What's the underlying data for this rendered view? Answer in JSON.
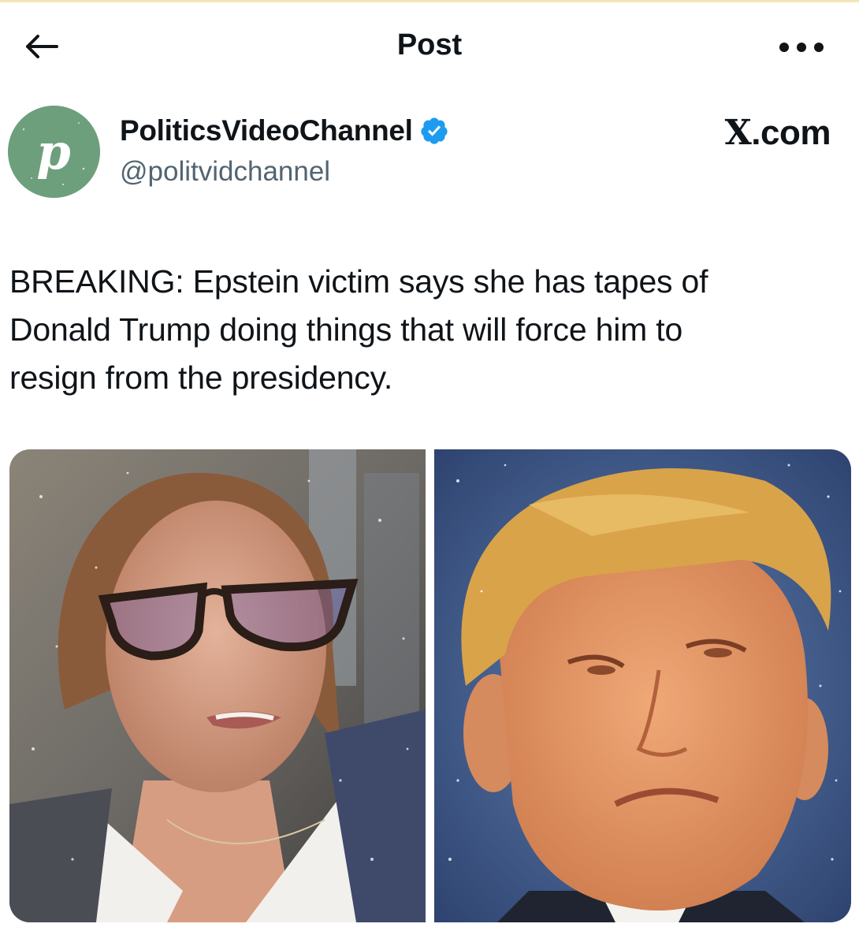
{
  "header": {
    "title": "Post",
    "back_icon": "arrow-left-icon",
    "more_icon": "more-horizontal-icon"
  },
  "author": {
    "name": "PoliticsVideoChannel",
    "handle": "@politvidchannel",
    "avatar_letter": "p",
    "avatar_color": "#6e9f7d",
    "verified_color": "#1d9bf0"
  },
  "brand": {
    "x_glyph": "X",
    "suffix": ".com"
  },
  "post": {
    "lines": [
      "BREAKING: Epstein victim says she has tapes of",
      "Donald Trump doing things that will force him to",
      "resign from the presidency."
    ]
  },
  "media": {
    "left_icon": "photo-woman-glasses",
    "right_icon": "photo-man-portrait"
  }
}
